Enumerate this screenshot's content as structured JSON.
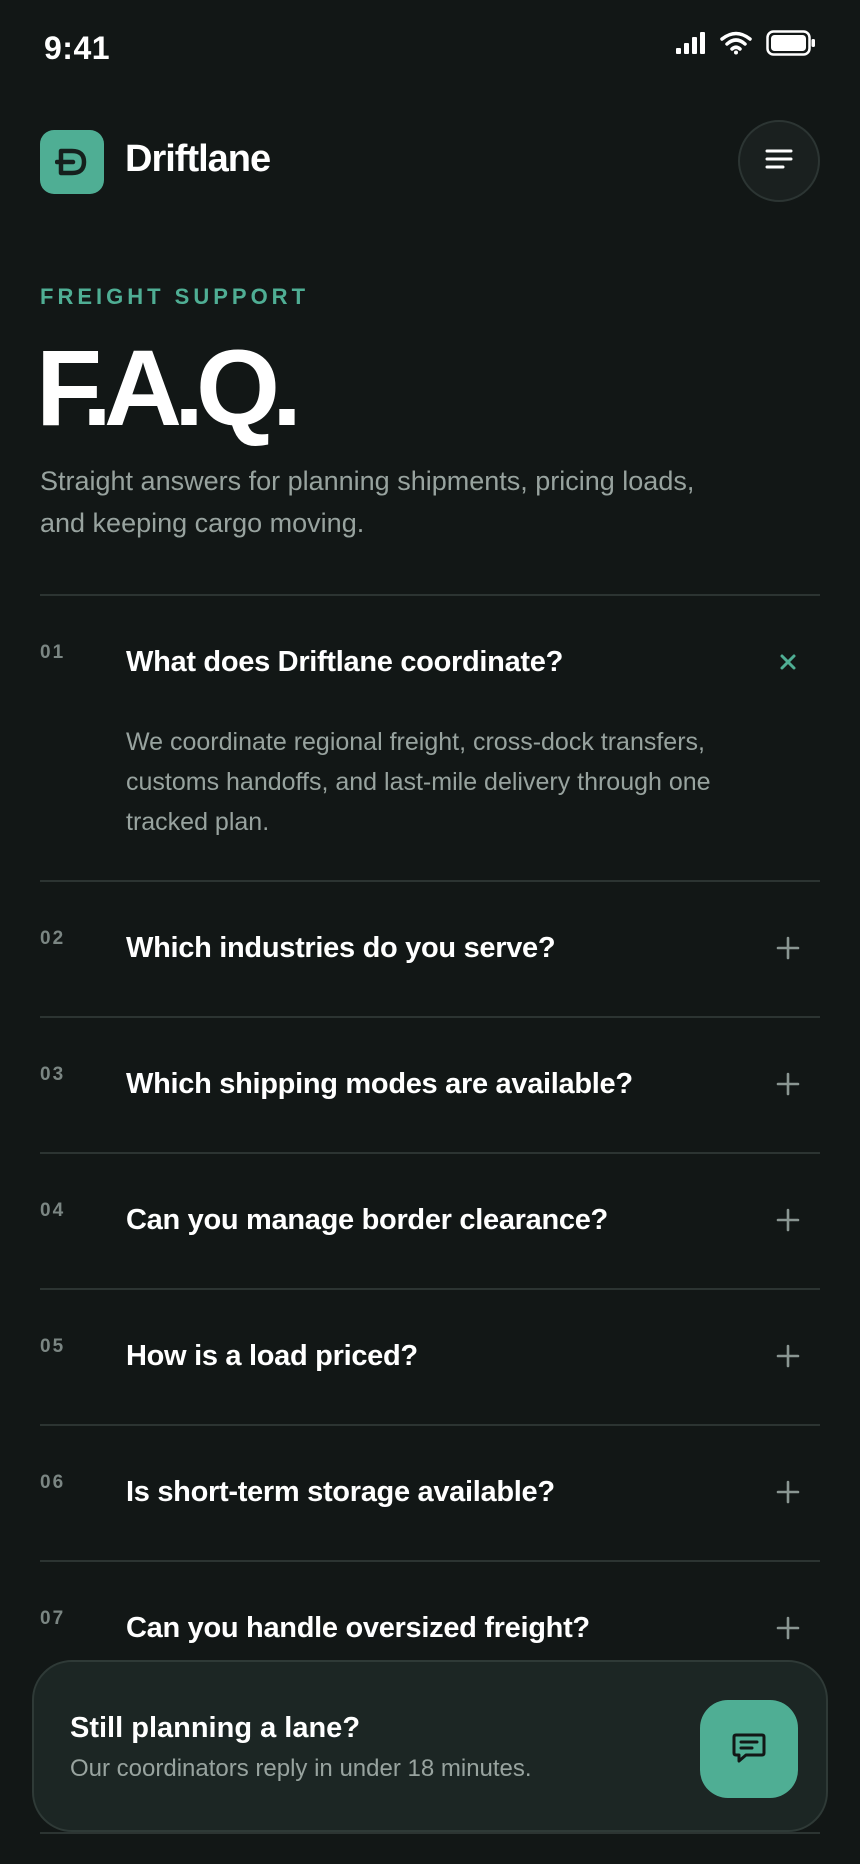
{
  "status_bar": {
    "time": "9:41",
    "icons": [
      "cellular-signal-icon",
      "wifi-icon",
      "battery-icon"
    ]
  },
  "header": {
    "brand": "Driftlane",
    "logo_letter": "Ð",
    "menu_icon": "menu-icon"
  },
  "hero": {
    "eyebrow": "FREIGHT SUPPORT",
    "title": "F.A.Q.",
    "intro": "Straight answers for planning shipments, pricing loads, and keeping cargo moving."
  },
  "faq": {
    "items": [
      {
        "number": "01",
        "question": "What does Driftlane coordinate?",
        "answer": "We coordinate regional freight, cross-dock transfers, customs handoffs, and last-mile delivery through one tracked plan.",
        "expanded": true
      },
      {
        "number": "02",
        "question": "Which industries do you serve?",
        "expanded": false
      },
      {
        "number": "03",
        "question": "Which shipping modes are available?",
        "expanded": false
      },
      {
        "number": "04",
        "question": "Can you manage border clearance?",
        "expanded": false
      },
      {
        "number": "05",
        "question": "How is a load priced?",
        "expanded": false
      },
      {
        "number": "06",
        "question": "Is short-term storage available?",
        "expanded": false
      },
      {
        "number": "07",
        "question": "Can you handle oversized freight?",
        "expanded": false
      }
    ]
  },
  "cta": {
    "title": "Still planning a lane?",
    "subtitle": "Our coordinators reply in under 18 minutes.",
    "button_icon": "chat-icon"
  },
  "colors": {
    "background": "#121716",
    "accent": "#4fae94",
    "muted_text": "#98a39f",
    "divider": "#2c3432"
  }
}
